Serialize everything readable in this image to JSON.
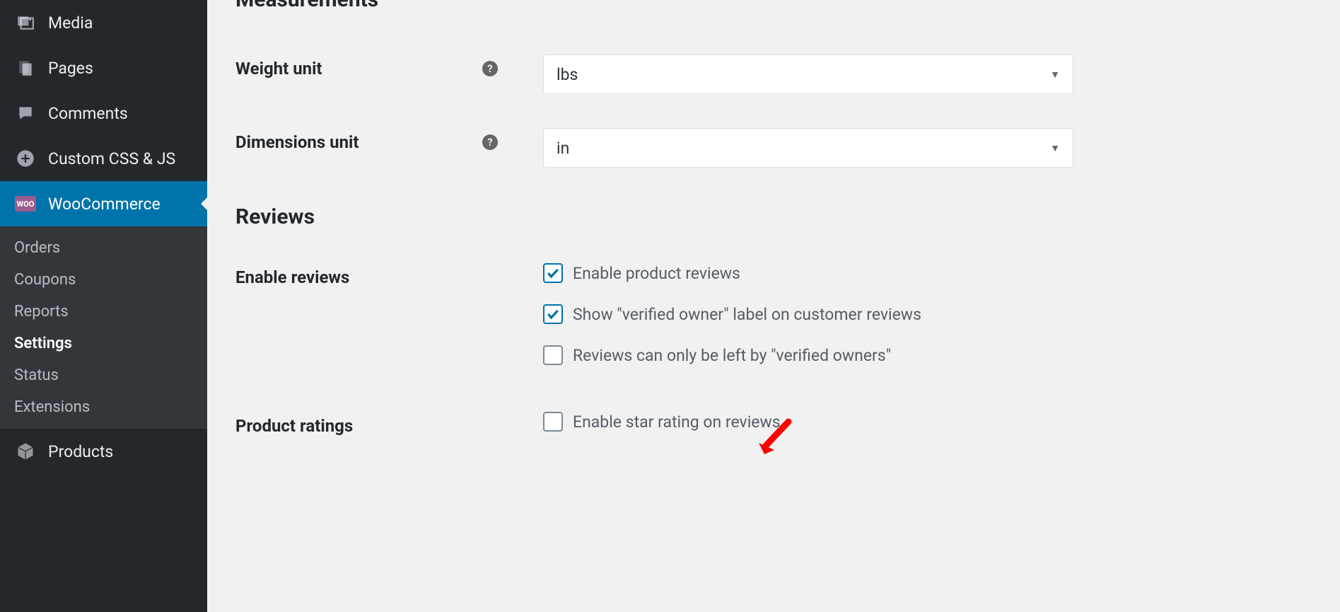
{
  "sidebar": {
    "items": [
      {
        "label": "Media",
        "icon": "media"
      },
      {
        "label": "Pages",
        "icon": "pages"
      },
      {
        "label": "Comments",
        "icon": "comment"
      },
      {
        "label": "Custom CSS & JS",
        "icon": "plus"
      },
      {
        "label": "WooCommerce",
        "icon": "woo"
      }
    ],
    "sub": [
      {
        "label": "Orders"
      },
      {
        "label": "Coupons"
      },
      {
        "label": "Reports"
      },
      {
        "label": "Settings"
      },
      {
        "label": "Status"
      },
      {
        "label": "Extensions"
      }
    ],
    "after": [
      {
        "label": "Products",
        "icon": "products"
      }
    ]
  },
  "main": {
    "section_measurements": "Measurements",
    "weight_unit_label": "Weight unit",
    "weight_unit_value": "lbs",
    "dimensions_unit_label": "Dimensions unit",
    "dimensions_unit_value": "in",
    "section_reviews": "Reviews",
    "enable_reviews_label": "Enable reviews",
    "reviews_checks": [
      {
        "label": "Enable product reviews",
        "checked": true
      },
      {
        "label": "Show \"verified owner\" label on customer reviews",
        "checked": true
      },
      {
        "label": "Reviews can only be left by \"verified owners\"",
        "checked": false
      }
    ],
    "product_ratings_label": "Product ratings",
    "ratings_checks": [
      {
        "label": "Enable star rating on reviews",
        "checked": false
      }
    ]
  }
}
